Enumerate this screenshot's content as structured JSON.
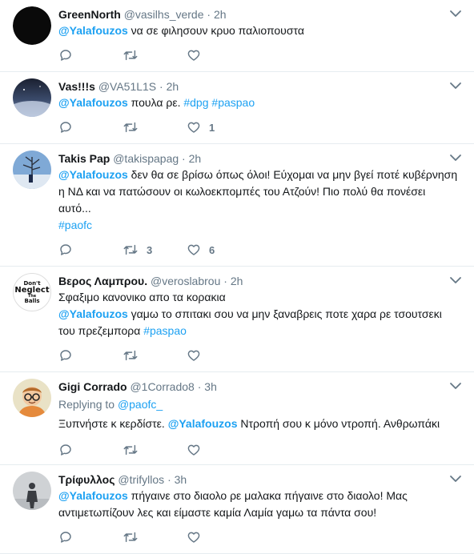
{
  "tweets": [
    {
      "name": "GreenNorth",
      "handle": "@vasilhs_verde",
      "dot": "·",
      "time": "2h",
      "lines": [
        [
          {
            "t": "@Yalafouzos",
            "k": "mention"
          },
          {
            "t": " να σε φιλησουν κρυο παλιοπουστα",
            "k": "text"
          }
        ]
      ],
      "replies": "",
      "retweets": "",
      "likes": ""
    },
    {
      "name": "Vas!!!s",
      "handle": "@VA51L1S",
      "dot": "·",
      "time": "2h",
      "lines": [
        [
          {
            "t": "@Yalafouzos",
            "k": "mention"
          },
          {
            "t": " πουλα ρε. ",
            "k": "text"
          },
          {
            "t": "#dpg",
            "k": "link"
          },
          {
            "t": " ",
            "k": "text"
          },
          {
            "t": "#paspao",
            "k": "link"
          }
        ]
      ],
      "replies": "",
      "retweets": "",
      "likes": "1"
    },
    {
      "name": "Takis Pap",
      "handle": "@takispapag",
      "dot": "·",
      "time": "2h",
      "lines": [
        [
          {
            "t": "@Yalafouzos",
            "k": "mention"
          },
          {
            "t": " δεν θα σε βρίσω όπως όλοι! Εύχομαι να μην βγεί ποτέ κυβέρνηση",
            "k": "text"
          }
        ],
        [
          {
            "t": "η ΝΔ και να πατώσουν οι κωλοεκπομπές του Ατζούν! Πιο πολύ θα πονέσει",
            "k": "text"
          }
        ],
        [
          {
            "t": "αυτό...",
            "k": "text"
          }
        ],
        [
          {
            "t": "#paofc",
            "k": "link"
          }
        ]
      ],
      "replies": "",
      "retweets": "3",
      "likes": "6"
    },
    {
      "name": "Βερος Λαμπρου.",
      "handle": "@veroslabrou",
      "dot": "·",
      "time": "2h",
      "lines": [
        [
          {
            "t": "Σφαξιμο κανονικο απο τα κορακια",
            "k": "text"
          }
        ],
        [
          {
            "t": "@Yalafouzos",
            "k": "mention"
          },
          {
            "t": " γαμω το σπιτακι σου να μην ξαναβρεις ποτε χαρα ρε τσουτσεκι",
            "k": "text"
          }
        ],
        [
          {
            "t": "του πρεζεμπορα ",
            "k": "text"
          },
          {
            "t": "#paspao",
            "k": "link"
          }
        ]
      ],
      "replies": "",
      "retweets": "",
      "likes": "",
      "avatar_text": [
        "Don't",
        "Neglect",
        "The",
        "Balls"
      ]
    },
    {
      "name": "Gigi Corrado",
      "handle": "@1Corrado8",
      "dot": "·",
      "time": "3h",
      "replying_label": "Replying to",
      "replying_to": "@paofc_",
      "lines": [
        [
          {
            "t": "Ξυπνήστε κ κερδίστε. ",
            "k": "text"
          },
          {
            "t": "@Yalafouzos",
            "k": "mention"
          },
          {
            "t": " Ντροπή σου κ μόνο ντροπή. Ανθρωπάκι",
            "k": "text"
          }
        ]
      ],
      "replies": "",
      "retweets": "",
      "likes": ""
    },
    {
      "name": "Τρίφυλλος",
      "handle": "@trifyllos",
      "dot": "·",
      "time": "3h",
      "lines": [
        [
          {
            "t": "@Yalafouzos",
            "k": "mention"
          },
          {
            "t": " πήγαινε στο διαολο ρε μαλακα πήγαινε στο διαολο! Μας",
            "k": "text"
          }
        ],
        [
          {
            "t": "αντιμετωπίζουν λες και είμαστε καμία Λαμία γαμω τα πάντα σου!",
            "k": "text"
          }
        ]
      ],
      "replies": "",
      "retweets": "",
      "likes": ""
    }
  ]
}
